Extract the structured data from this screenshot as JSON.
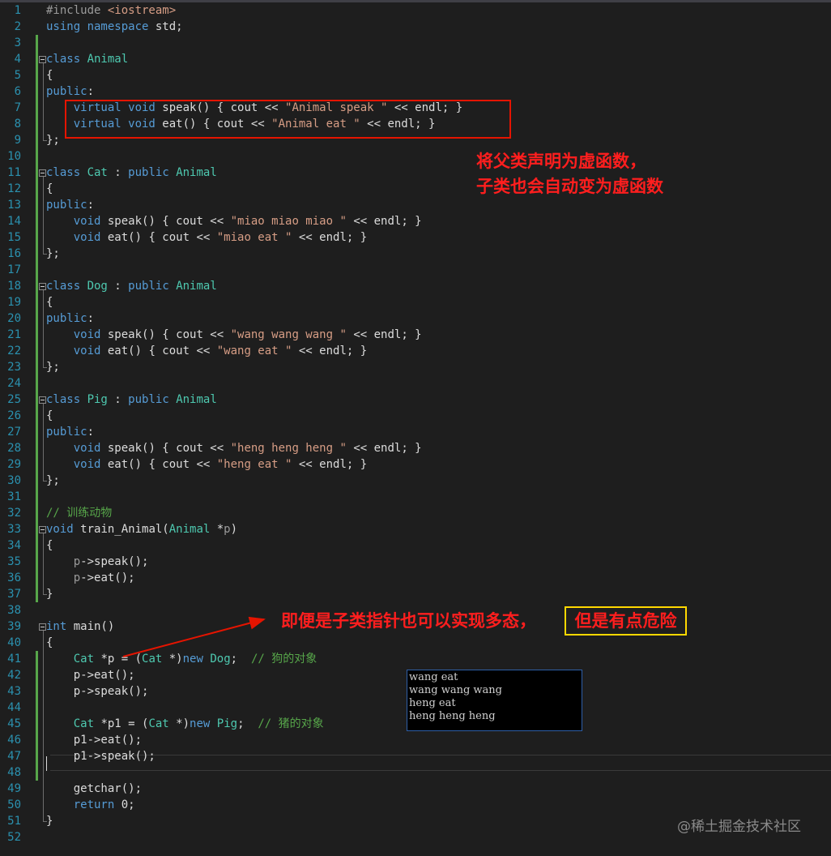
{
  "line_numbers": [
    "1",
    "2",
    "3",
    "4",
    "5",
    "6",
    "7",
    "8",
    "9",
    "10",
    "11",
    "12",
    "13",
    "14",
    "15",
    "16",
    "17",
    "18",
    "19",
    "20",
    "21",
    "22",
    "23",
    "24",
    "25",
    "26",
    "27",
    "28",
    "29",
    "30",
    "31",
    "32",
    "33",
    "34",
    "35",
    "36",
    "37",
    "38",
    "39",
    "40",
    "41",
    "42",
    "43",
    "44",
    "45",
    "46",
    "47",
    "48",
    "49",
    "50",
    "51",
    "52"
  ],
  "code_lines": [
    [
      {
        "c": "pp",
        "t": "#include "
      },
      {
        "c": "str",
        "t": "<iostream>"
      }
    ],
    [
      {
        "c": "kw",
        "t": "using namespace "
      },
      {
        "c": "def",
        "t": "std;"
      }
    ],
    [],
    [
      {
        "c": "kw",
        "t": "class "
      },
      {
        "c": "ty",
        "t": "Animal"
      }
    ],
    [
      {
        "c": "def",
        "t": "{"
      }
    ],
    [
      {
        "c": "kw",
        "t": "public"
      },
      {
        "c": "def",
        "t": ":"
      }
    ],
    [
      {
        "c": "def",
        "t": "    "
      },
      {
        "c": "kw",
        "t": "virtual void "
      },
      {
        "c": "def",
        "t": "speak() { cout << "
      },
      {
        "c": "str",
        "t": "\"Animal speak \""
      },
      {
        "c": "def",
        "t": " << endl; }"
      }
    ],
    [
      {
        "c": "def",
        "t": "    "
      },
      {
        "c": "kw",
        "t": "virtual void "
      },
      {
        "c": "def",
        "t": "eat() { cout << "
      },
      {
        "c": "str",
        "t": "\"Animal eat \""
      },
      {
        "c": "def",
        "t": " << endl; }"
      }
    ],
    [
      {
        "c": "def",
        "t": "};"
      }
    ],
    [],
    [
      {
        "c": "kw",
        "t": "class "
      },
      {
        "c": "ty",
        "t": "Cat"
      },
      {
        "c": "def",
        "t": " : "
      },
      {
        "c": "kw",
        "t": "public "
      },
      {
        "c": "ty",
        "t": "Animal"
      }
    ],
    [
      {
        "c": "def",
        "t": "{"
      }
    ],
    [
      {
        "c": "kw",
        "t": "public"
      },
      {
        "c": "def",
        "t": ":"
      }
    ],
    [
      {
        "c": "def",
        "t": "    "
      },
      {
        "c": "kw",
        "t": "void "
      },
      {
        "c": "def",
        "t": "speak() { cout << "
      },
      {
        "c": "str",
        "t": "\"miao miao miao \""
      },
      {
        "c": "def",
        "t": " << endl; }"
      }
    ],
    [
      {
        "c": "def",
        "t": "    "
      },
      {
        "c": "kw",
        "t": "void "
      },
      {
        "c": "def",
        "t": "eat() { cout << "
      },
      {
        "c": "str",
        "t": "\"miao eat \""
      },
      {
        "c": "def",
        "t": " << endl; }"
      }
    ],
    [
      {
        "c": "def",
        "t": "};"
      }
    ],
    [],
    [
      {
        "c": "kw",
        "t": "class "
      },
      {
        "c": "ty",
        "t": "Dog"
      },
      {
        "c": "def",
        "t": " : "
      },
      {
        "c": "kw",
        "t": "public "
      },
      {
        "c": "ty",
        "t": "Animal"
      }
    ],
    [
      {
        "c": "def",
        "t": "{"
      }
    ],
    [
      {
        "c": "kw",
        "t": "public"
      },
      {
        "c": "def",
        "t": ":"
      }
    ],
    [
      {
        "c": "def",
        "t": "    "
      },
      {
        "c": "kw",
        "t": "void "
      },
      {
        "c": "def",
        "t": "speak() { cout << "
      },
      {
        "c": "str",
        "t": "\"wang wang wang \""
      },
      {
        "c": "def",
        "t": " << endl; }"
      }
    ],
    [
      {
        "c": "def",
        "t": "    "
      },
      {
        "c": "kw",
        "t": "void "
      },
      {
        "c": "def",
        "t": "eat() { cout << "
      },
      {
        "c": "str",
        "t": "\"wang eat \""
      },
      {
        "c": "def",
        "t": " << endl; }"
      }
    ],
    [
      {
        "c": "def",
        "t": "};"
      }
    ],
    [],
    [
      {
        "c": "kw",
        "t": "class "
      },
      {
        "c": "ty",
        "t": "Pig"
      },
      {
        "c": "def",
        "t": " : "
      },
      {
        "c": "kw",
        "t": "public "
      },
      {
        "c": "ty",
        "t": "Animal"
      }
    ],
    [
      {
        "c": "def",
        "t": "{"
      }
    ],
    [
      {
        "c": "kw",
        "t": "public"
      },
      {
        "c": "def",
        "t": ":"
      }
    ],
    [
      {
        "c": "def",
        "t": "    "
      },
      {
        "c": "kw",
        "t": "void "
      },
      {
        "c": "def",
        "t": "speak() { cout << "
      },
      {
        "c": "str",
        "t": "\"heng heng heng \""
      },
      {
        "c": "def",
        "t": " << endl; }"
      }
    ],
    [
      {
        "c": "def",
        "t": "    "
      },
      {
        "c": "kw",
        "t": "void "
      },
      {
        "c": "def",
        "t": "eat() { cout << "
      },
      {
        "c": "str",
        "t": "\"heng eat \""
      },
      {
        "c": "def",
        "t": " << endl; }"
      }
    ],
    [
      {
        "c": "def",
        "t": "};"
      }
    ],
    [],
    [
      {
        "c": "com",
        "t": "// 训练动物"
      }
    ],
    [
      {
        "c": "kw",
        "t": "void "
      },
      {
        "c": "def",
        "t": "train_Animal("
      },
      {
        "c": "ty",
        "t": "Animal"
      },
      {
        "c": "def",
        "t": " *"
      },
      {
        "c": "par",
        "t": "p"
      },
      {
        "c": "def",
        "t": ")"
      }
    ],
    [
      {
        "c": "def",
        "t": "{"
      }
    ],
    [
      {
        "c": "def",
        "t": "    "
      },
      {
        "c": "par",
        "t": "p"
      },
      {
        "c": "def",
        "t": "->speak();"
      }
    ],
    [
      {
        "c": "def",
        "t": "    "
      },
      {
        "c": "par",
        "t": "p"
      },
      {
        "c": "def",
        "t": "->eat();"
      }
    ],
    [
      {
        "c": "def",
        "t": "}"
      }
    ],
    [],
    [
      {
        "c": "kw",
        "t": "int "
      },
      {
        "c": "def",
        "t": "main()"
      }
    ],
    [
      {
        "c": "def",
        "t": "{"
      }
    ],
    [
      {
        "c": "def",
        "t": "    "
      },
      {
        "c": "ty",
        "t": "Cat"
      },
      {
        "c": "def",
        "t": " *p = ("
      },
      {
        "c": "ty",
        "t": "Cat"
      },
      {
        "c": "def",
        "t": " *)"
      },
      {
        "c": "kw",
        "t": "new "
      },
      {
        "c": "ty",
        "t": "Dog"
      },
      {
        "c": "def",
        "t": ";  "
      },
      {
        "c": "com",
        "t": "// 狗的对象"
      }
    ],
    [
      {
        "c": "def",
        "t": "    p->eat();"
      }
    ],
    [
      {
        "c": "def",
        "t": "    p->speak();"
      }
    ],
    [],
    [
      {
        "c": "def",
        "t": "    "
      },
      {
        "c": "ty",
        "t": "Cat"
      },
      {
        "c": "def",
        "t": " *p1 = ("
      },
      {
        "c": "ty",
        "t": "Cat"
      },
      {
        "c": "def",
        "t": " *)"
      },
      {
        "c": "kw",
        "t": "new "
      },
      {
        "c": "ty",
        "t": "Pig"
      },
      {
        "c": "def",
        "t": ";  "
      },
      {
        "c": "com",
        "t": "// 猪的对象"
      }
    ],
    [
      {
        "c": "def",
        "t": "    p1->eat();"
      }
    ],
    [
      {
        "c": "def",
        "t": "    p1->speak();"
      }
    ],
    [],
    [
      {
        "c": "def",
        "t": "    getchar();"
      }
    ],
    [
      {
        "c": "def",
        "t": "    "
      },
      {
        "c": "kw",
        "t": "return "
      },
      {
        "c": "def",
        "t": "0;"
      }
    ],
    [
      {
        "c": "def",
        "t": "}"
      }
    ],
    []
  ],
  "annotations": {
    "note1_line1": "将父类声明为虚函数，",
    "note1_line2": "子类也会自动变为虚函数",
    "note2_main": "即便是子类指针也可以实现多态，",
    "note2_highlight": "但是有点危险"
  },
  "console": {
    "lines": [
      "wang eat",
      "wang wang wang",
      "heng eat",
      "heng heng heng"
    ]
  },
  "watermark": "@稀土掘金技术社区",
  "colors": {
    "keyword": "#569cd6",
    "type": "#4ec9b0",
    "string": "#d69d85",
    "comment": "#57a64a",
    "line_number": "#2b91af",
    "annotation_red": "#ff1e1e",
    "highlight_yellow": "#ffd800"
  }
}
